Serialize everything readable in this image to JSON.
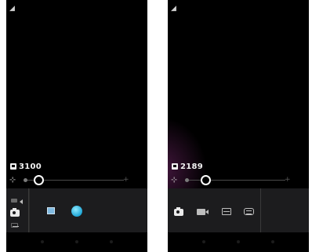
{
  "screens": [
    {
      "id": "left",
      "status": {
        "signal_glyph": "◢"
      },
      "counter": {
        "value": "3100"
      },
      "exposure": {
        "icon": "exposure-icon",
        "glyph": "⊹",
        "end_glyph": "+",
        "level_fraction": 0.15
      },
      "mode_strip": [
        "video-mode-icon",
        "camera-mode-icon",
        "panorama-mode-icon"
      ],
      "tray_items": [
        "gallery-thumbnail",
        "sphere-globe-icon"
      ]
    },
    {
      "id": "right",
      "status": {
        "signal_glyph": "◢"
      },
      "counter": {
        "value": "2189"
      },
      "exposure": {
        "icon": "exposure-icon",
        "glyph": "⊹",
        "end_glyph": "+",
        "level_fraction": 0.2
      },
      "tray_items": [
        "camera-icon",
        "video-camera-icon",
        "panorama-icon",
        "photosphere-icon"
      ]
    }
  ],
  "colors": {
    "screen_bg": "#000000",
    "tray_bg": "#1c1c1e",
    "accent_globe": "#1fa6d6"
  }
}
